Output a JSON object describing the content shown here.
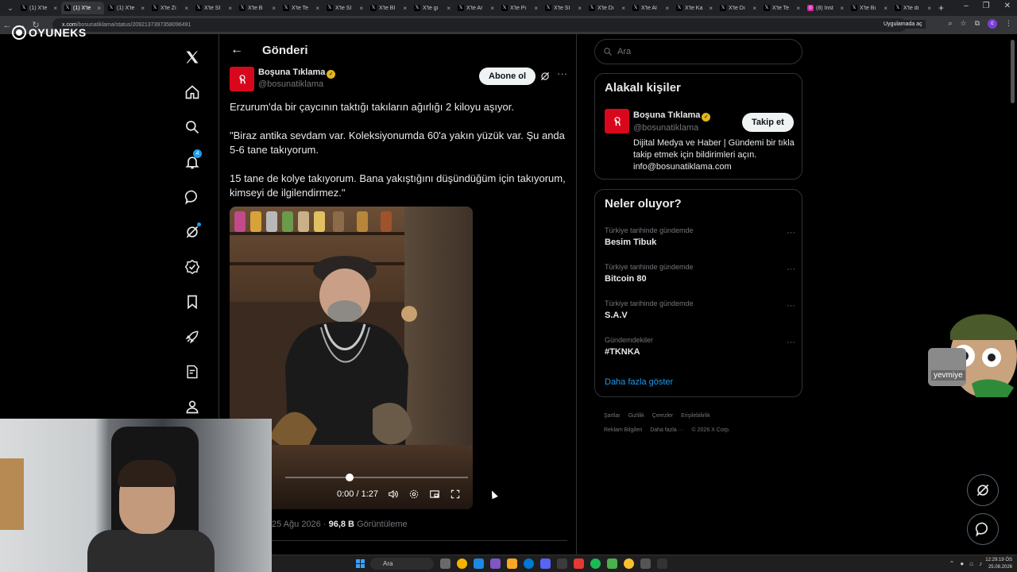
{
  "browser": {
    "tabs": [
      {
        "label": "(1) X'te",
        "icon": "x-icon",
        "active": false
      },
      {
        "label": "(1) X'te",
        "icon": "x-icon",
        "active": true
      },
      {
        "label": "(1) X'te",
        "icon": "x-icon",
        "active": false
      },
      {
        "label": "X'te Zi",
        "icon": "x-icon",
        "active": false
      },
      {
        "label": "X'te Sİ",
        "icon": "x-icon",
        "active": false
      },
      {
        "label": "X'te B",
        "icon": "x-icon",
        "active": false
      },
      {
        "label": "X'te Te",
        "icon": "x-icon",
        "active": false
      },
      {
        "label": "X'te Sİ",
        "icon": "x-icon",
        "active": false
      },
      {
        "label": "X'te Bİ",
        "icon": "x-icon",
        "active": false
      },
      {
        "label": "X'te gi",
        "icon": "x-icon",
        "active": false
      },
      {
        "label": "X'te Ar",
        "icon": "x-icon",
        "active": false
      },
      {
        "label": "X'te Pi",
        "icon": "x-icon",
        "active": false
      },
      {
        "label": "X'te Sİ",
        "icon": "x-icon",
        "active": false
      },
      {
        "label": "X'te Dı",
        "icon": "x-icon",
        "active": false
      },
      {
        "label": "X'te Al",
        "icon": "x-icon",
        "active": false
      },
      {
        "label": "X'te Ka",
        "icon": "x-icon",
        "active": false
      },
      {
        "label": "X'te Dı",
        "icon": "x-icon",
        "active": false
      },
      {
        "label": "X'te Te",
        "icon": "x-icon",
        "active": false
      },
      {
        "label": "(8) Inst",
        "icon": "instagram-icon",
        "active": false
      },
      {
        "label": "X'te Bı",
        "icon": "x-icon",
        "active": false
      },
      {
        "label": "X'te di",
        "icon": "x-icon",
        "active": false
      }
    ],
    "url_host": "x.com",
    "url_path": "/bosunatiklama/status/2092137397358096491",
    "open_in_app": "Uygulamada aç",
    "profile_initial": "c"
  },
  "watermark": {
    "brand": "OYUNEKS"
  },
  "post": {
    "header_title": "Gönderi",
    "author_name": "Boşuna Tıklama",
    "author_handle": "@bosunatiklama",
    "subscribe_label": "Abone ol",
    "paragraphs": [
      "Erzurum'da bir çaycının taktığı takıların ağırlığı 2 kiloyu aşıyor.",
      "\"Biraz antika sevdam var. Koleksiyonumda 60'a yakın yüzük var. Şu anda 5-6 tane takıyorum.",
      "15 tane de kolye takıyorum. Bana yakıştığını düşündüğüm için takıyorum, kimseyi de ilgilendirmez.\""
    ],
    "video": {
      "time": "0:00 / 1:27",
      "progress": 0.0
    },
    "date": "25 Ağu 2026",
    "views": "96,8 B",
    "views_label": "Görüntüleme"
  },
  "nav": {
    "notification_count": "4"
  },
  "sidebar": {
    "search_placeholder": "Ara",
    "related": {
      "title": "Alakalı kişiler",
      "name": "Boşuna Tıklama",
      "handle": "@bosunatiklama",
      "follow_label": "Takip et",
      "bio": "Dijital Medya ve Haber | Gündemi bir tıkla takip etmek için bildirimleri açın. info@bosunatiklama.com"
    },
    "trends": {
      "title": "Neler oluyor?",
      "items": [
        {
          "context": "Türkiye tarihinde gündemde",
          "name": "Besim Tibuk"
        },
        {
          "context": "Türkiye tarihinde gündemde",
          "name": "Bitcoin 80"
        },
        {
          "context": "Türkiye tarihinde gündemde",
          "name": "S.A.V"
        },
        {
          "context": "Gündemdekiler",
          "name": "#TKNKA"
        }
      ],
      "show_more": "Daha fazla göster"
    },
    "footer": [
      "Şartlar",
      "Gizlilik",
      "Çerezler",
      "Erişilebilirlik",
      "Reklam Bilgileri",
      "Daha fazla ···",
      "© 2026 X Corp."
    ]
  },
  "overlay": {
    "sticker_text": "yevmiye"
  },
  "taskbar": {
    "search_label": "Ara",
    "time": "12:29:19 ÖS",
    "date": "25.08.2026"
  }
}
